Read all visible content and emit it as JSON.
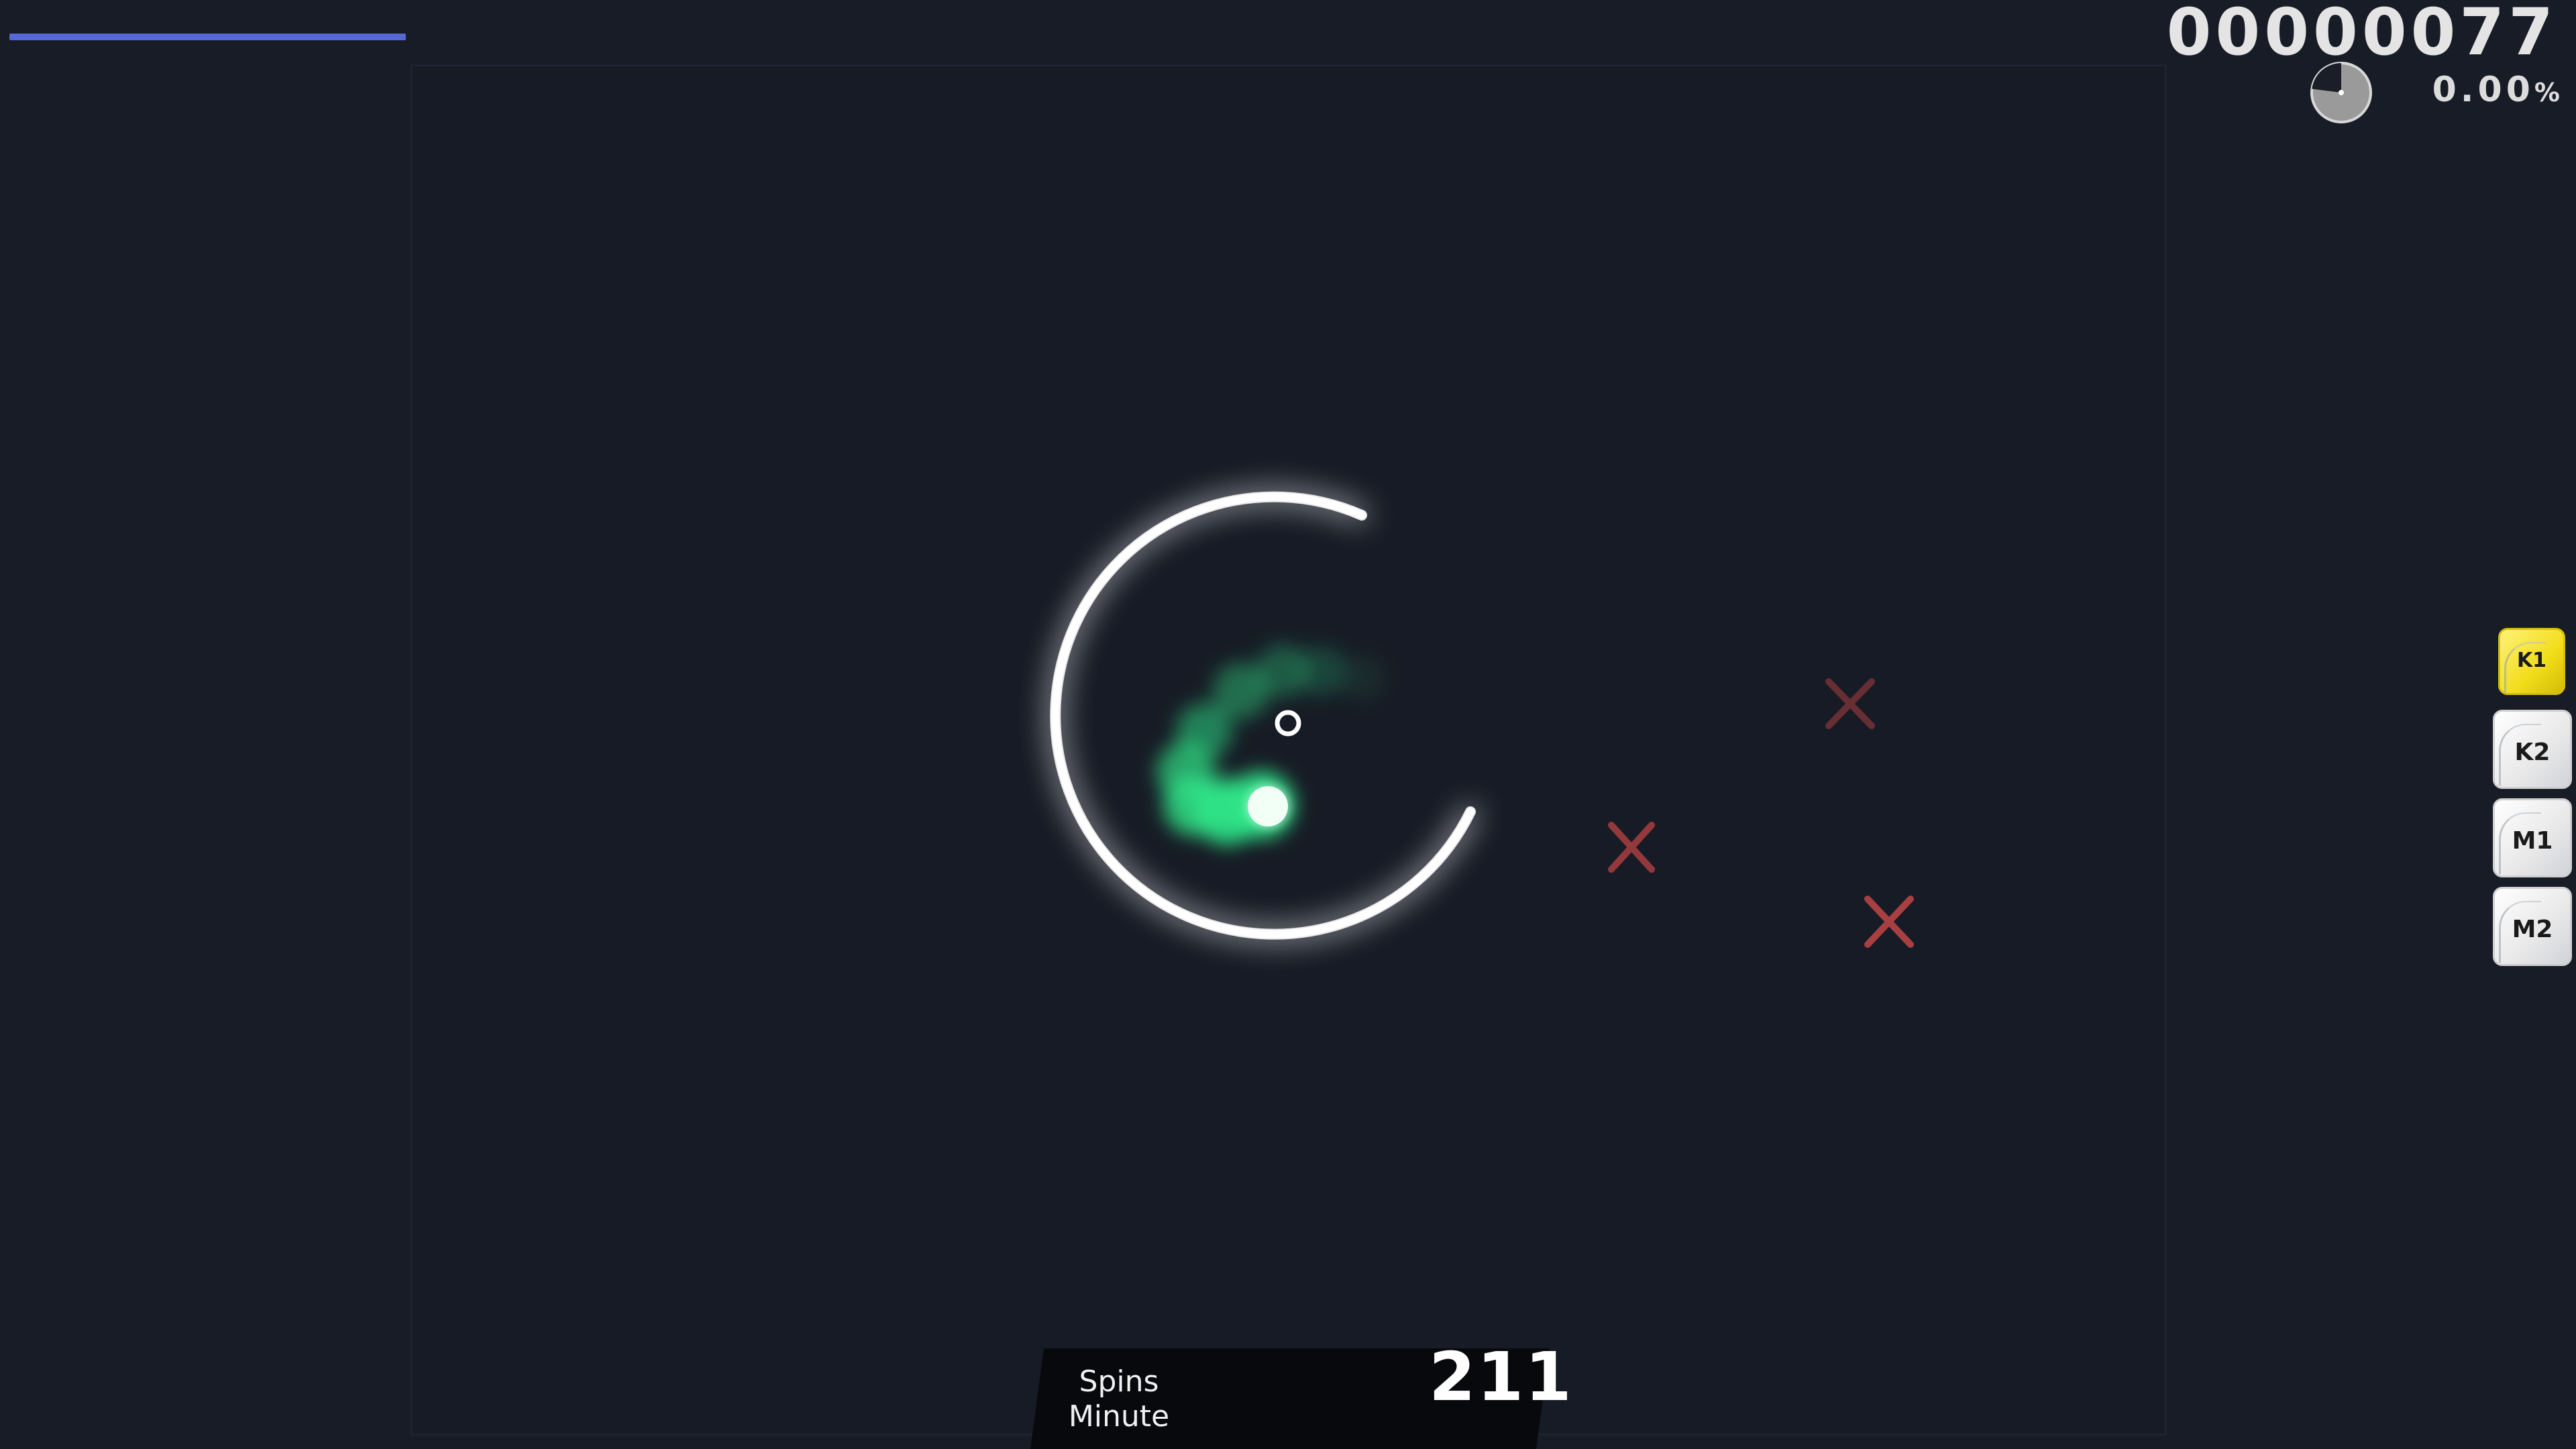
{
  "hud": {
    "score": "00000077",
    "accuracy": "0.00",
    "accuracy_unit": "%",
    "health_fraction": 0.3,
    "song_progress_fraction": 0.23
  },
  "spinner": {
    "spm_label": "Spins\nMinute",
    "spm_value": "211"
  },
  "key_overlay": [
    {
      "label": "K1",
      "pressed": true
    },
    {
      "label": "K2",
      "pressed": false
    },
    {
      "label": "M1",
      "pressed": false
    },
    {
      "label": "M2",
      "pressed": false
    }
  ],
  "miss_markers_count": 3,
  "colors": {
    "background": "#171c26",
    "health_bar": "#5468d6",
    "cursor_trail": "#2ee88a",
    "miss_marker": "#d94b4b",
    "key_pressed": "#f2dd1a"
  }
}
